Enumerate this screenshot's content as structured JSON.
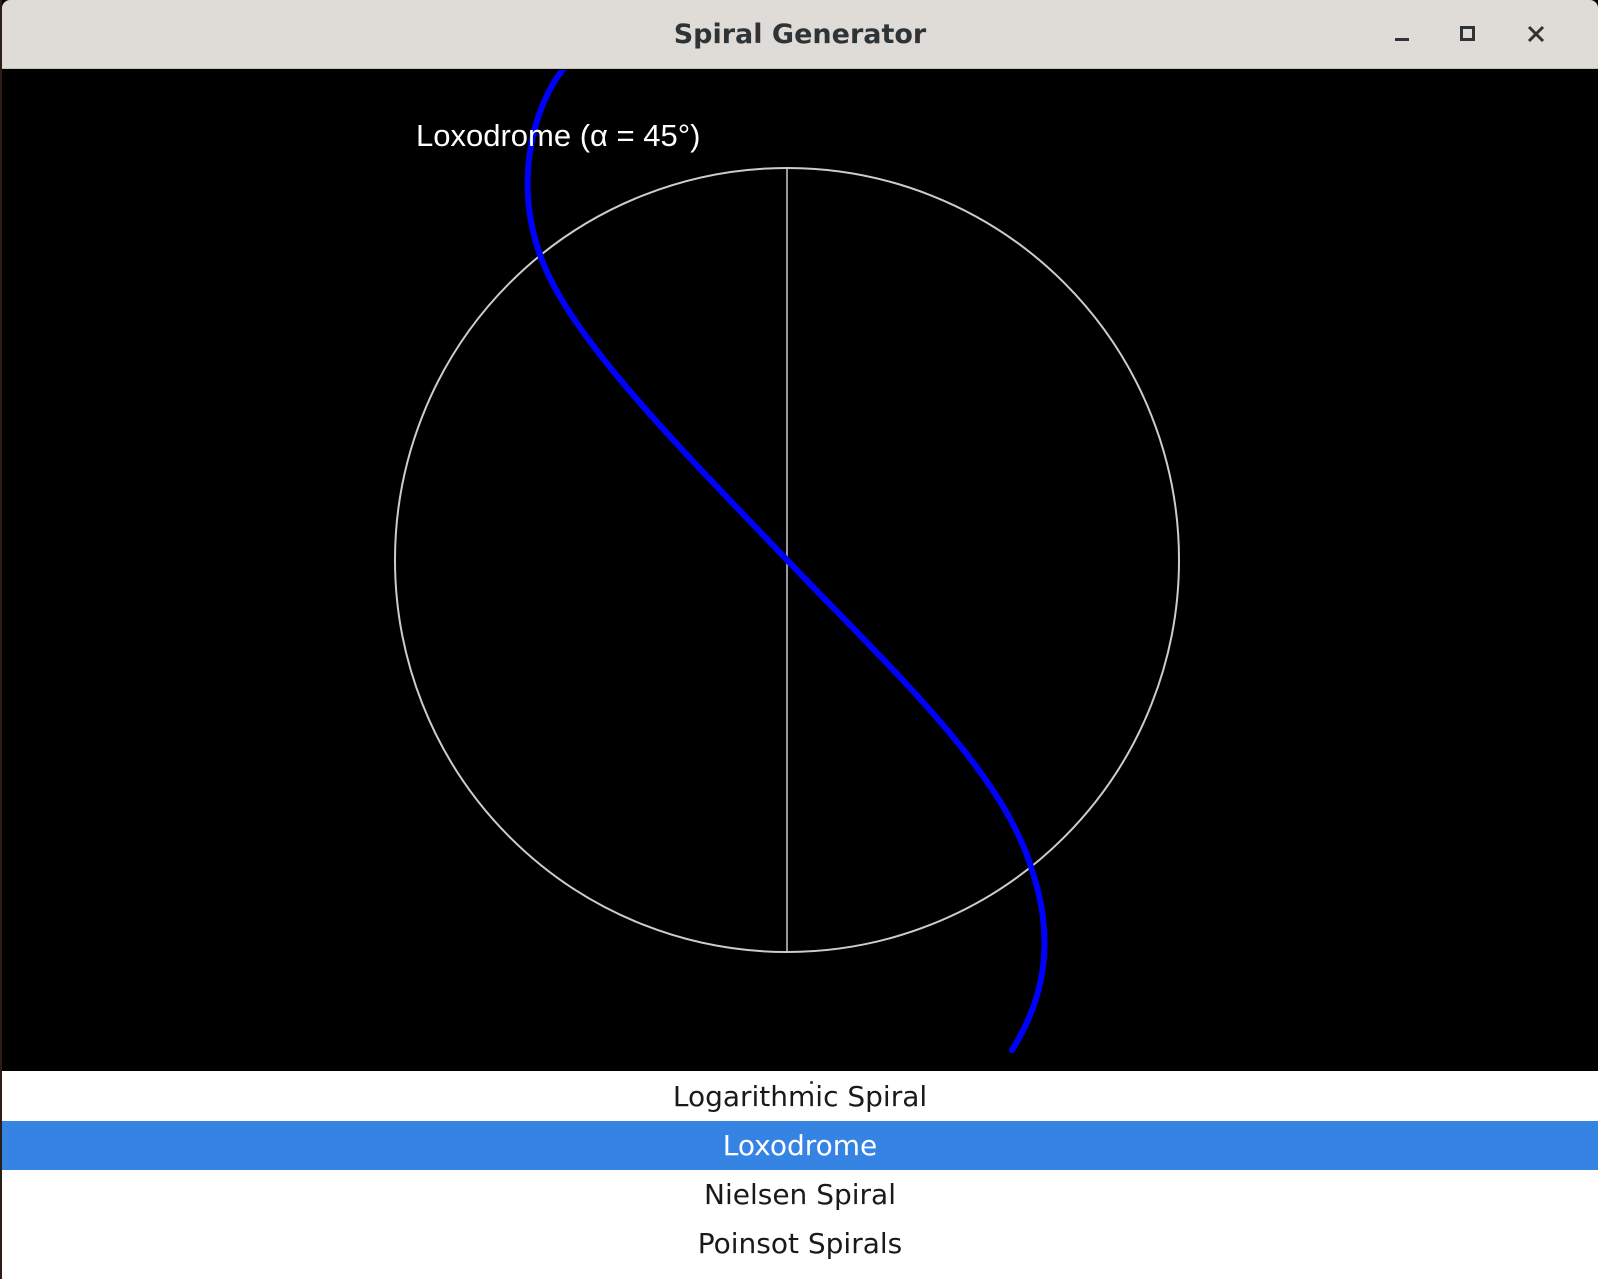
{
  "window": {
    "title": "Spiral Generator"
  },
  "canvas": {
    "curve_label": "Loxodrome (α = 45°)",
    "background": "#000000",
    "curve_color": "#0000ff",
    "guide_color": "#cccccc"
  },
  "spiral_list": {
    "items": [
      {
        "label": "Logarithmic Spiral",
        "selected": false
      },
      {
        "label": "Loxodrome",
        "selected": true
      },
      {
        "label": "Nielsen Spiral",
        "selected": false
      },
      {
        "label": "Poinsot Spirals",
        "selected": false
      }
    ],
    "selected_color": "#3584e4"
  }
}
